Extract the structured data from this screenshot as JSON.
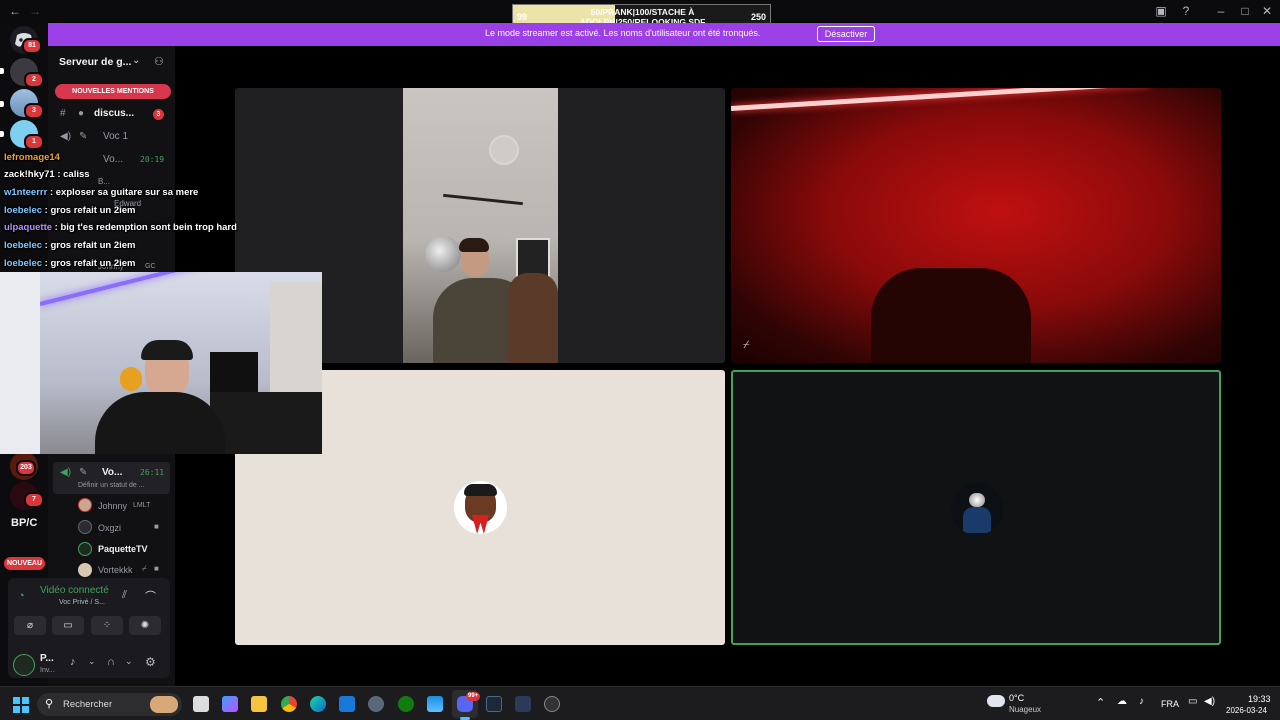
{
  "goal_bar": {
    "left_value": "99",
    "right_value": "250",
    "line1": "50/PRANK|100/STACHE À",
    "line2": "ADOLPH|250/RELOOKING SDF",
    "progress": 0.396
  },
  "banner": {
    "message": "Le mode streamer est activé. Les noms d'utilisateur ont été tronqués.",
    "button": "Désactiver"
  },
  "rail": {
    "home_badge": "81",
    "badges": [
      "2",
      "3",
      "1",
      "203",
      "7"
    ],
    "text_server": "BP/C",
    "new_label": "NOUVEAU"
  },
  "sidebar": {
    "server_name": "Serveur de g...",
    "mentions": "NOUVELLES MENTIONS",
    "text_channel": "discus...",
    "text_channel_badge": "3",
    "voice_channel_1": "Voc 1",
    "voice_channel_2": "Vo...",
    "voice_channel_2_time": "20:19",
    "voice_channel_3": "Vo...",
    "voice_channel_3_time": "26:11",
    "voice_channel_3_status": "Définir un statut de ...",
    "hidden_members": [
      "B...",
      "Edward",
      "Johnny"
    ],
    "hidden_member_tag": "GC",
    "members": [
      {
        "name": "Johnny",
        "tag": "LMLT"
      },
      {
        "name": "Oxgzi",
        "tag": ""
      },
      {
        "name": "PaquetteTV",
        "tag": ""
      },
      {
        "name": "Vortekkk",
        "tag": ""
      }
    ]
  },
  "chat": [
    {
      "user": "lefromage14",
      "text": "",
      "color": "#f0a030"
    },
    {
      "user": "zack!hky71",
      "text": ": caliss",
      "color": "#ffffff"
    },
    {
      "user": "w1nteerrr",
      "text": ": exploser sa guitare sur sa mere",
      "color": "#7ec8ff"
    },
    {
      "user": "loebelec",
      "text": ": gros refait un 2iem",
      "color": "#7ec8ff"
    },
    {
      "user": "ulpaquette",
      "text": ": big t'es redemption sont bein trop hard",
      "color": "#b98cff"
    },
    {
      "user": "loebelec",
      "text": ": gros refait un 2iem",
      "color": "#7ec8ff"
    },
    {
      "user": "loebelec",
      "text": ": gros refait un 2iem",
      "color": "#7ec8ff"
    }
  ],
  "voice_panel": {
    "status": "Vidéo connecté",
    "channel": "Voc Privé / S...",
    "user_name": "P...",
    "user_status": "Inv..."
  },
  "taskbar": {
    "search_placeholder": "Rechercher",
    "weather_temp": "0°C",
    "weather_desc": "Nuageux",
    "lang": "FRA",
    "time": "19:33",
    "date": "2026-03-24",
    "discord_badge": "99+"
  },
  "colors": {
    "banner": "#9b3fe6",
    "mention_pill": "#d6374c",
    "speaking_border": "#43a25a",
    "connected_green": "#43a25a"
  }
}
